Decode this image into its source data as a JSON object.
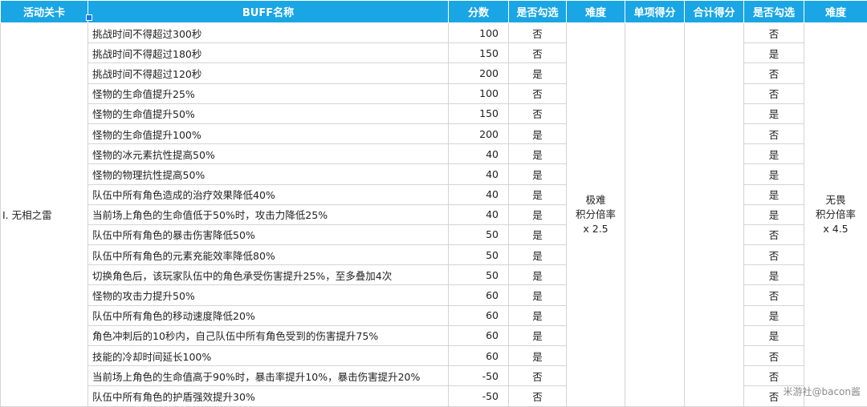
{
  "headers": [
    "活动关卡",
    "BUFF名称",
    "分数",
    "是否勾选",
    "难度",
    "单项得分",
    "合计得分",
    "是否勾选",
    "难度"
  ],
  "stage": "I. 无相之雷",
  "difficulty_left": [
    "极难",
    "积分倍率",
    "x 2.5"
  ],
  "difficulty_right": [
    "无畏",
    "积分倍率",
    "x 4.5"
  ],
  "rows": [
    {
      "name": "挑战时间不得超过300秒",
      "score": "100",
      "check1": "否",
      "check2": "否"
    },
    {
      "name": "挑战时间不得超过180秒",
      "score": "150",
      "check1": "否",
      "check2": "是"
    },
    {
      "name": "挑战时间不得超过120秒",
      "score": "200",
      "check1": "是",
      "check2": "否"
    },
    {
      "name": "怪物的生命值提升25%",
      "score": "100",
      "check1": "否",
      "check2": "否"
    },
    {
      "name": "怪物的生命值提升50%",
      "score": "150",
      "check1": "否",
      "check2": "是"
    },
    {
      "name": "怪物的生命值提升100%",
      "score": "200",
      "check1": "是",
      "check2": "否"
    },
    {
      "name": "怪物的冰元素抗性提高50%",
      "score": "40",
      "check1": "是",
      "check2": "是"
    },
    {
      "name": "怪物的物理抗性提高50%",
      "score": "40",
      "check1": "是",
      "check2": "是"
    },
    {
      "name": "队伍中所有角色造成的治疗效果降低40%",
      "score": "40",
      "check1": "是",
      "check2": "是"
    },
    {
      "name": "当前场上角色的生命值低于50%时，攻击力降低25%",
      "score": "40",
      "check1": "是",
      "check2": "是"
    },
    {
      "name": "队伍中所有角色的暴击伤害降低50%",
      "score": "50",
      "check1": "是",
      "check2": "否"
    },
    {
      "name": "队伍中所有角色的元素充能效率降低80%",
      "score": "50",
      "check1": "是",
      "check2": "否"
    },
    {
      "name": "切换角色后，该玩家队伍中的角色承受伤害提升25%，至多叠加4次",
      "score": "50",
      "check1": "是",
      "check2": "是"
    },
    {
      "name": "怪物的攻击力提升50%",
      "score": "60",
      "check1": "是",
      "check2": "否"
    },
    {
      "name": "队伍中所有角色的移动速度降低20%",
      "score": "60",
      "check1": "是",
      "check2": "是"
    },
    {
      "name": "角色冲刺后的10秒内，自己队伍中所有角色受到的伤害提升75%",
      "score": "60",
      "check1": "是",
      "check2": "是"
    },
    {
      "name": "技能的冷却时间延长100%",
      "score": "60",
      "check1": "是",
      "check2": "否"
    },
    {
      "name": "当前场上角色的生命值高于90%时，暴击率提升10%，暴击伤害提升20%",
      "score": "-50",
      "check1": "否",
      "check2": "否"
    },
    {
      "name": "队伍中所有角色的护盾强效提升30%",
      "score": "-50",
      "check1": "否",
      "check2": "否"
    }
  ],
  "watermark": "米游社@bacon酱",
  "colors": {
    "header_bg": "#1aa6e4",
    "header_text": "#ffffff",
    "grid": "#d4d4d4"
  }
}
